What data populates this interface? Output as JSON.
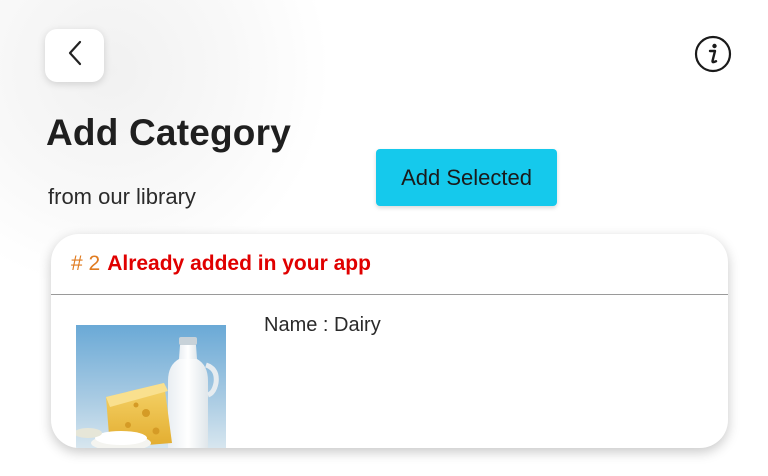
{
  "header": {
    "back_icon": "chevron-left-icon",
    "info_icon": "info-circle-icon",
    "title": "Add Category",
    "subtitle": "from our library"
  },
  "actions": {
    "add_selected_label": "Add Selected",
    "add_selected_color": "#15c9ec"
  },
  "category_card": {
    "number": "# 2",
    "status": "Already added in your app",
    "status_color": "#e00000",
    "number_color": "#e07b20",
    "name_label": "Name : Dairy",
    "image": "dairy-products-image"
  }
}
